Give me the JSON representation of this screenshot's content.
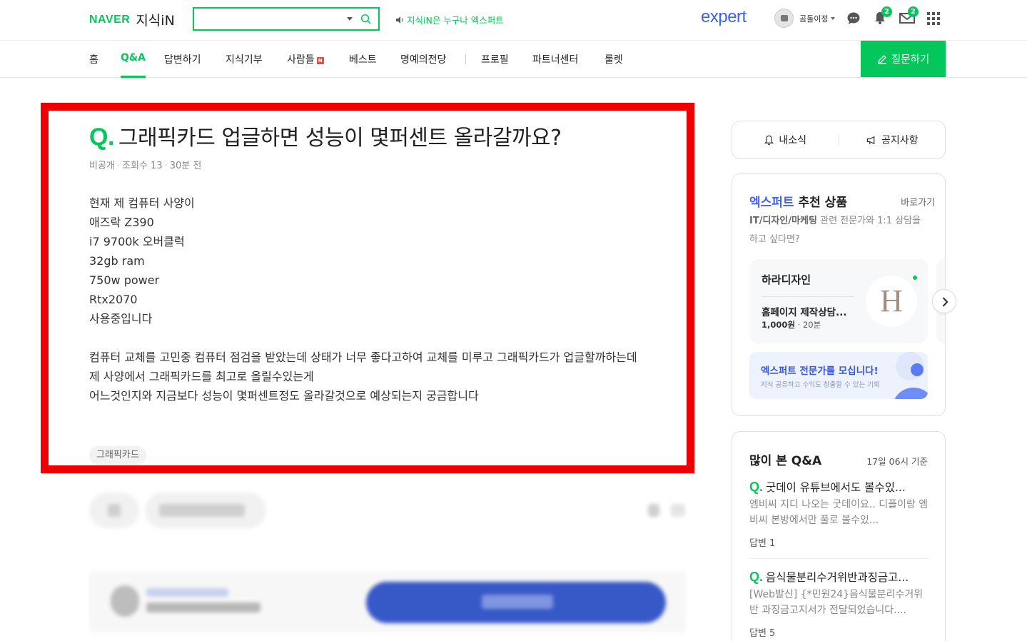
{
  "header": {
    "logo_brand": "NAVER",
    "logo_service": "지식iN",
    "search_placeholder": "",
    "promo_text": "지식iN은 누구나 엑스퍼트",
    "expert_logo": "expert",
    "user_name": "곰돌이정",
    "notifications_count": "2",
    "messages_count": "2"
  },
  "nav": {
    "items": [
      {
        "label": "홈"
      },
      {
        "label": "Q&A"
      },
      {
        "label": "답변하기"
      },
      {
        "label": "지식기부"
      },
      {
        "label": "사람들"
      },
      {
        "label": "베스트"
      },
      {
        "label": "명예의전당"
      },
      {
        "label": "프로필"
      },
      {
        "label": "파트너센터"
      },
      {
        "label": "룰렛"
      }
    ],
    "new_badge": "N",
    "ask_button": "질문하기"
  },
  "question": {
    "q_prefix": "Q.",
    "title": "그래픽카드 업글하면 성능이 몇퍼센트 올라갈까요?",
    "visibility": "비공개",
    "views": "조회수 13",
    "time_ago": "30분 전",
    "body_lines": [
      "현재 제 컴퓨터 사양이",
      "애즈락 Z390",
      "i7 9700k 오버클럭",
      "32gb ram",
      "750w power",
      "Rtx2070",
      "사용중입니다",
      "",
      "컴퓨터 교체를 고민중 컴퓨터 점검을 받았는데 상태가 너무 좋다고하여 교체를 미루고 그래픽카드가 업글할까하는데",
      "제 사양에서 그래픽카드를 최고로 올릴수있는게",
      "어느것인지와 지금보다 성능이 몇퍼센트정도 올라갈것으로 예상되는지 궁금합니다"
    ],
    "tag": "그래픽카드"
  },
  "sidebar": {
    "tabs": [
      {
        "label": "내소식"
      },
      {
        "label": "공지사항"
      }
    ],
    "expert": {
      "title_blue": "엑스퍼트",
      "title_rest": "추천 상품",
      "link": "바로가기",
      "desc_bold": "IT/디자인/마케팅",
      "desc_rest": "관련 전문가와 1:1 상담을 하고 싶다면?",
      "product": {
        "name": "하라디자인",
        "title": "홈페이지 제작상담...",
        "price": "1,000원",
        "duration": "20분",
        "logo_letter": "H"
      },
      "recruit_title": "엑스퍼트 전문가를 모십니다!",
      "recruit_sub": "지식 공유하고 수익도 창출할 수 있는 기회"
    },
    "top_qa": {
      "title": "많이 본 Q&A",
      "time": "17일 06시 기준",
      "items": [
        {
          "q": "Q.",
          "title": "굿데이 유튜브에서도 볼수있...",
          "desc": "엠비씨 지디 나오는 굿데이요.. 디플이랑 엠비씨 본방에서만 풀로 볼수있...",
          "answers": "답변 1"
        },
        {
          "q": "Q.",
          "title": "음식물분리수거위반과징금고...",
          "desc": "[Web발신] {*민원24}음식물분리수거위반 과징금고지서가 전달되었습니다....",
          "answers": "답변 5"
        }
      ]
    }
  },
  "colors": {
    "brand_green": "#03c75a",
    "expert_blue": "#4263eb",
    "highlight_red": "#ee0000"
  }
}
